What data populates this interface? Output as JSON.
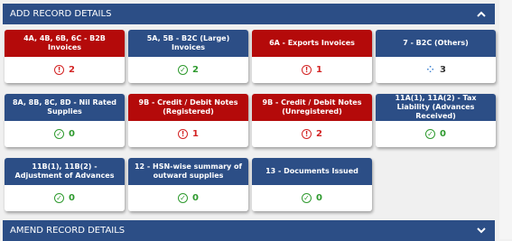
{
  "add_section": {
    "title": "ADD RECORD DETAILS",
    "toggle": "^"
  },
  "amend_section": {
    "title": "AMEND RECORD DETAILS",
    "toggle": "v"
  },
  "tiles": [
    {
      "title": "4A, 4B, 6B, 6C - B2B Invoices",
      "status": "error",
      "count": "2"
    },
    {
      "title": "5A, 5B - B2C (Large) Invoices",
      "status": "ok",
      "count": "2"
    },
    {
      "title": "6A - Exports Invoices",
      "status": "error",
      "count": "1"
    },
    {
      "title": "7 - B2C (Others)",
      "status": "pending",
      "count": "3"
    },
    {
      "title": "8A, 8B, 8C, 8D - Nil Rated Supplies",
      "status": "ok",
      "count": "0"
    },
    {
      "title": "9B - Credit / Debit Notes (Registered)",
      "status": "error",
      "count": "1"
    },
    {
      "title": "9B - Credit / Debit Notes (Unregistered)",
      "status": "error",
      "count": "2"
    },
    {
      "title": "11A(1), 11A(2) - Tax Liability (Advances Received)",
      "status": "ok",
      "count": "0"
    },
    {
      "title": "11B(1), 11B(2) - Adjustment of Advances",
      "status": "ok",
      "count": "0"
    },
    {
      "title": "12 - HSN-wise summary of outward supplies",
      "status": "ok",
      "count": "0"
    },
    {
      "title": "13 - Documents Issued",
      "status": "ok",
      "count": "0"
    }
  ],
  "icons": {
    "error": "!",
    "ok": "✓",
    "pending": "⁘"
  },
  "colors": {
    "header_blue": "#2c4e86",
    "error_red": "#b40a0a",
    "ok_green": "#2e9a2e"
  }
}
